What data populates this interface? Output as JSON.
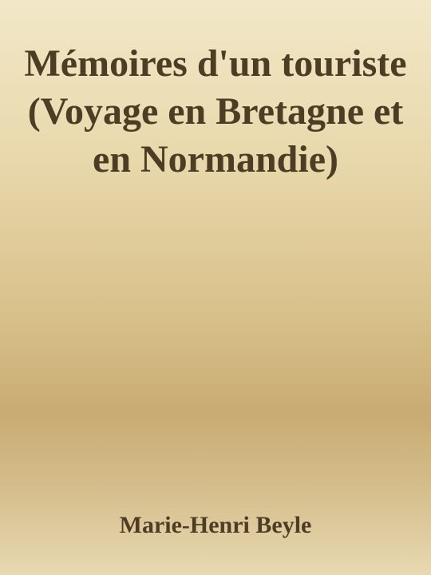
{
  "book": {
    "title": "Mémoires d'un touriste (Voyage en Bretagne et en Normandie)",
    "author": "Marie-Henri Beyle"
  },
  "colors": {
    "background_top": "#f2e8c8",
    "background_middle": "#c8ab72",
    "text": "#4d3d24"
  }
}
